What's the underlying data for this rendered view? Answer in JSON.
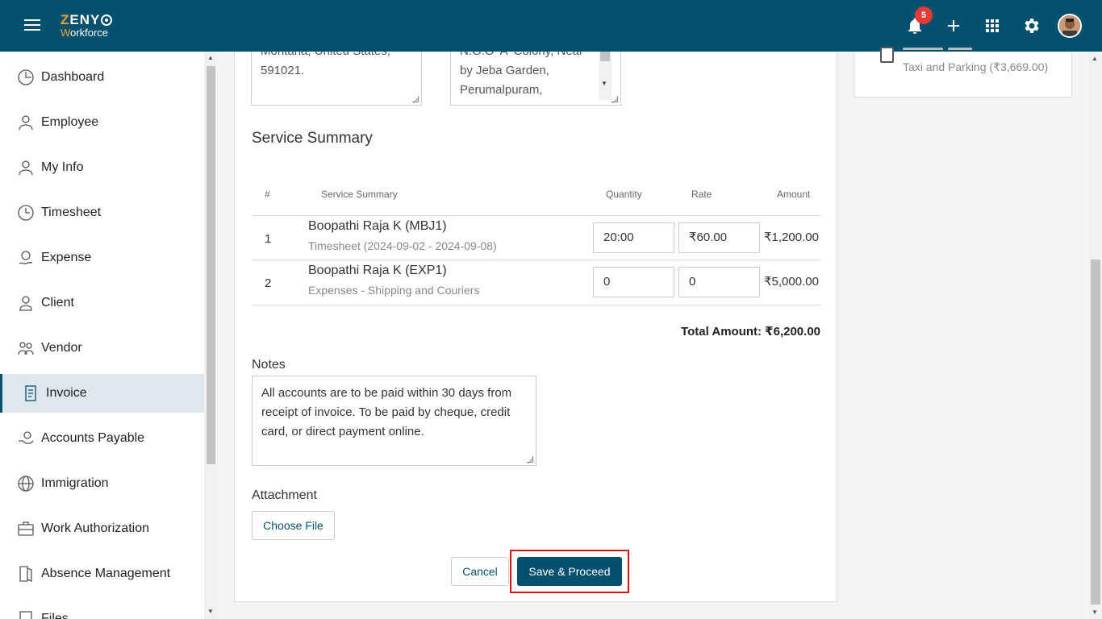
{
  "header": {
    "brand_main": "ZENY",
    "brand_sub": "Workforce",
    "notification_count": "5"
  },
  "sidebar": {
    "items": [
      {
        "label": "Dashboard",
        "icon": "dashboard-icon"
      },
      {
        "label": "Employee",
        "icon": "employee-icon"
      },
      {
        "label": "My Info",
        "icon": "myinfo-icon"
      },
      {
        "label": "Timesheet",
        "icon": "clock-icon"
      },
      {
        "label": "Expense",
        "icon": "expense-icon"
      },
      {
        "label": "Client",
        "icon": "client-icon"
      },
      {
        "label": "Vendor",
        "icon": "vendor-icon"
      },
      {
        "label": "Invoice",
        "icon": "invoice-icon",
        "active": true
      },
      {
        "label": "Accounts Payable",
        "icon": "accounts-payable-icon"
      },
      {
        "label": "Immigration",
        "icon": "globe-icon"
      },
      {
        "label": "Work Authorization",
        "icon": "briefcase-icon"
      },
      {
        "label": "Absence Management",
        "icon": "door-icon"
      },
      {
        "label": "Files",
        "icon": "files-icon"
      }
    ]
  },
  "address": {
    "bill_to_lines": [
      "Montana, United States,",
      "591021."
    ],
    "ship_to_lines": [
      "N.G.O 'A' Colony, Near",
      "by Jeba Garden,",
      "Perumalpuram,"
    ]
  },
  "service_summary": {
    "title": "Service Summary",
    "headers": {
      "num": "#",
      "summary": "Service Summary",
      "quantity": "Quantity",
      "rate": "Rate",
      "amount": "Amount"
    },
    "rows": [
      {
        "num": "1",
        "name": "Boopathi Raja K (MBJ1)",
        "detail": "Timesheet (2024-09-02 - 2024-09-08)",
        "quantity": "20:00",
        "rate": "₹60.00",
        "amount": "₹1,200.00"
      },
      {
        "num": "2",
        "name": "Boopathi Raja K (EXP1)",
        "detail": "Expenses - Shipping and Couriers",
        "quantity": "0",
        "rate": "0",
        "amount": "₹5,000.00"
      }
    ],
    "total": "Total Amount: ₹6,200.00"
  },
  "notes": {
    "label": "Notes",
    "value": "All accounts are to be paid within 30 days from receipt of invoice. To be paid by cheque, credit card, or direct payment online."
  },
  "attachment": {
    "label": "Attachment",
    "button": "Choose File"
  },
  "actions": {
    "cancel": "Cancel",
    "save": "Save & Proceed"
  },
  "right_panel": {
    "item_text": "Taxi and Parking (₹3,669.00)"
  },
  "colors": {
    "primary": "#04506f",
    "badge": "#e53935",
    "highlight": "#dd1111"
  }
}
